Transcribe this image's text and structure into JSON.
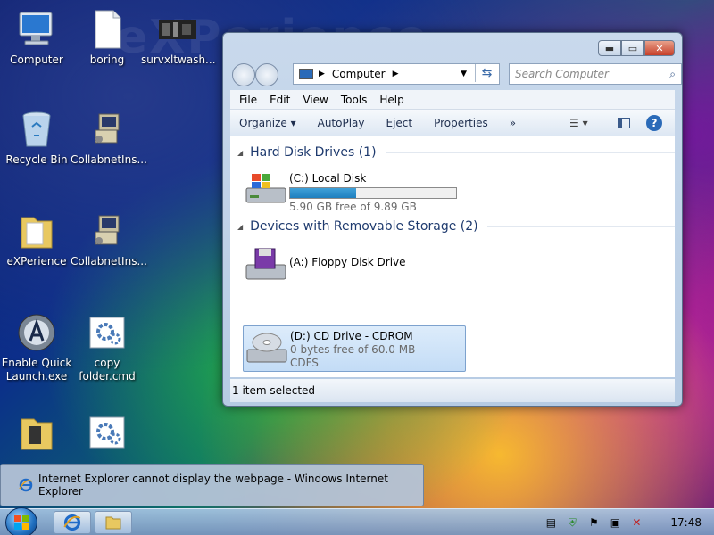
{
  "desktop": {
    "watermark": "eXPerience",
    "icons": [
      {
        "label": "Computer"
      },
      {
        "label": "boring"
      },
      {
        "label": "survxltwash..."
      },
      {
        "label": "Recycle Bin"
      },
      {
        "label": "CollabnetIns..."
      },
      {
        "label": "eXPerience"
      },
      {
        "label": "CollabnetIns..."
      },
      {
        "label": "Enable Quick Launch.exe"
      },
      {
        "label": "copy folder.cmd"
      }
    ]
  },
  "window": {
    "address_label": "Computer",
    "search_placeholder": "Search Computer",
    "menu": [
      "File",
      "Edit",
      "View",
      "Tools",
      "Help"
    ],
    "commands": [
      "Organize ▾",
      "AutoPlay",
      "Eject",
      "Properties",
      "»"
    ],
    "groups": [
      {
        "title": "Hard Disk Drives (1)",
        "drives": [
          {
            "name": "(C:) Local Disk",
            "free": "5.90 GB free of 9.89 GB",
            "used_fraction": 0.4
          }
        ]
      },
      {
        "title": "Devices with Removable Storage (2)",
        "drives": [
          {
            "name": "(A:) Floppy Disk Drive"
          },
          {
            "name": "(D:) CD Drive - CDROM",
            "free": "0 bytes free of 60.0 MB",
            "fs": "CDFS",
            "selected": true
          }
        ]
      }
    ],
    "status": "1 item selected"
  },
  "popup": {
    "text": "Internet Explorer cannot display the webpage - Windows Internet Explorer"
  },
  "taskbar": {
    "clock": "17:48"
  },
  "colors": {
    "accent": "#1e7fbf",
    "selection": "#c3dcf6",
    "close_button": "#c6402a"
  }
}
